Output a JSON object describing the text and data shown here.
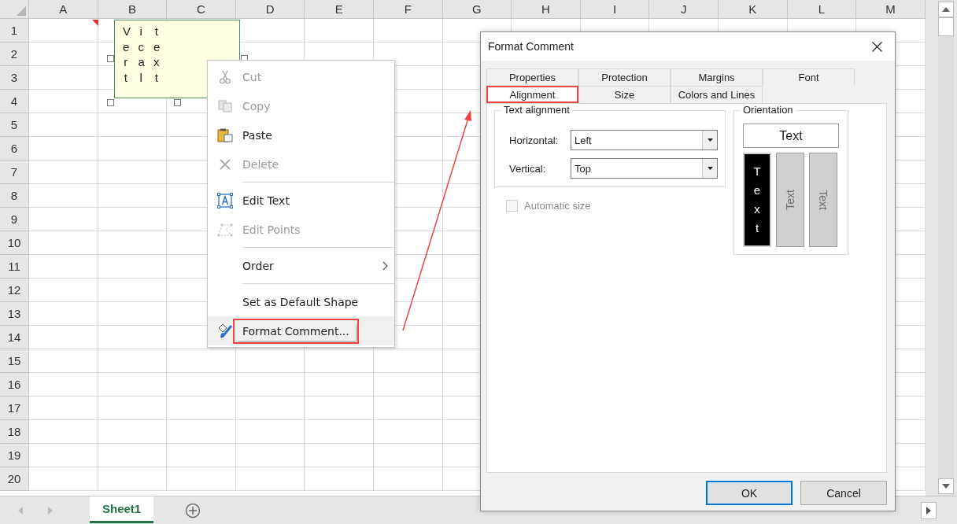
{
  "sheet": {
    "columns": [
      "A",
      "B",
      "C",
      "D",
      "E",
      "F",
      "G",
      "H",
      "I",
      "J",
      "K",
      "L",
      "M"
    ],
    "rows": [
      "1",
      "2",
      "3",
      "4",
      "5",
      "6",
      "7",
      "8",
      "9",
      "10",
      "11",
      "12",
      "13",
      "14",
      "15",
      "16",
      "17",
      "18",
      "19",
      "20"
    ]
  },
  "comment": {
    "columns": [
      "Vert",
      "ical",
      "text"
    ]
  },
  "context_menu": {
    "items": [
      {
        "kind": "command",
        "label": "Cut",
        "disabled": true,
        "highlighted": false
      },
      {
        "kind": "command",
        "label": "Copy",
        "disabled": true,
        "highlighted": false
      },
      {
        "kind": "command",
        "label": "Paste",
        "disabled": false,
        "highlighted": false
      },
      {
        "kind": "command",
        "label": "Delete",
        "disabled": true,
        "highlighted": false
      },
      {
        "kind": "separator"
      },
      {
        "kind": "command",
        "label": "Edit Text",
        "disabled": false,
        "highlighted": false
      },
      {
        "kind": "command",
        "label": "Edit Points",
        "disabled": true,
        "highlighted": false
      },
      {
        "kind": "separator"
      },
      {
        "kind": "submenu",
        "label": "Order",
        "disabled": false,
        "highlighted": false
      },
      {
        "kind": "separator"
      },
      {
        "kind": "command",
        "label": "Set as Default Shape",
        "disabled": false,
        "highlighted": false
      },
      {
        "kind": "command",
        "label": "Format Comment...",
        "disabled": false,
        "highlighted": true
      }
    ]
  },
  "dialog": {
    "title": "Format Comment",
    "tab_rows": [
      [
        {
          "label": "Properties",
          "selected": false,
          "highlighted": false
        },
        {
          "label": "Protection",
          "selected": false,
          "highlighted": false
        },
        {
          "label": "Margins",
          "selected": false,
          "highlighted": false
        },
        {
          "label": "Font",
          "selected": false,
          "highlighted": false
        }
      ],
      [
        {
          "label": "Alignment",
          "selected": true,
          "highlighted": true
        },
        {
          "label": "Size",
          "selected": false,
          "highlighted": false
        },
        {
          "label": "Colors and Lines",
          "selected": false,
          "highlighted": false
        }
      ]
    ],
    "text_alignment": {
      "title": "Text alignment",
      "fields": [
        {
          "label": "Horizontal:",
          "value": "Left"
        },
        {
          "label": "Vertical:",
          "value": "Top"
        }
      ]
    },
    "automatic_size": {
      "label": "Automatic size",
      "checked": false,
      "disabled": true
    },
    "orientation": {
      "title": "Orientation",
      "options": [
        {
          "kind": "horizontal",
          "label": "Text",
          "selected": false
        },
        {
          "kind": "stacked",
          "label": "Text",
          "selected": true
        },
        {
          "kind": "rotated_up",
          "label": "Text",
          "selected": false
        },
        {
          "kind": "rotated_down",
          "label": "Text",
          "selected": false
        }
      ]
    },
    "buttons": [
      {
        "label": "OK",
        "default": true
      },
      {
        "label": "Cancel",
        "default": false
      }
    ]
  },
  "sheet_tabs": [
    {
      "label": "Sheet1",
      "selected": true
    }
  ]
}
